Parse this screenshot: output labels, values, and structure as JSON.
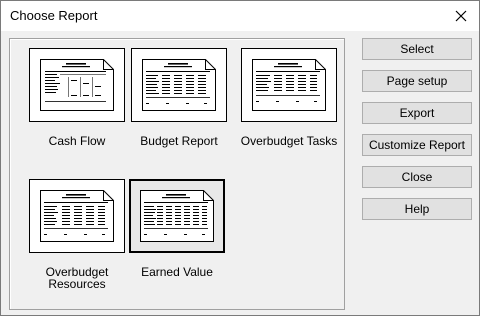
{
  "window": {
    "title": "Choose Report",
    "close_icon": "close-x-icon"
  },
  "reports": [
    {
      "label": "Cash Flow",
      "icon": "report-document-icon",
      "selected": false
    },
    {
      "label": "Budget Report",
      "icon": "report-document-icon",
      "selected": false
    },
    {
      "label": "Overbudget Tasks",
      "icon": "report-document-icon",
      "selected": false
    },
    {
      "label": "Overbudget\nResources",
      "icon": "report-document-icon",
      "selected": false
    },
    {
      "label": "Earned Value",
      "icon": "report-document-icon",
      "selected": true
    }
  ],
  "buttons": {
    "select": "Select",
    "page_setup": "Page setup",
    "export": "Export",
    "customize_report": "Customize Report",
    "close": "Close",
    "help": "Help"
  }
}
